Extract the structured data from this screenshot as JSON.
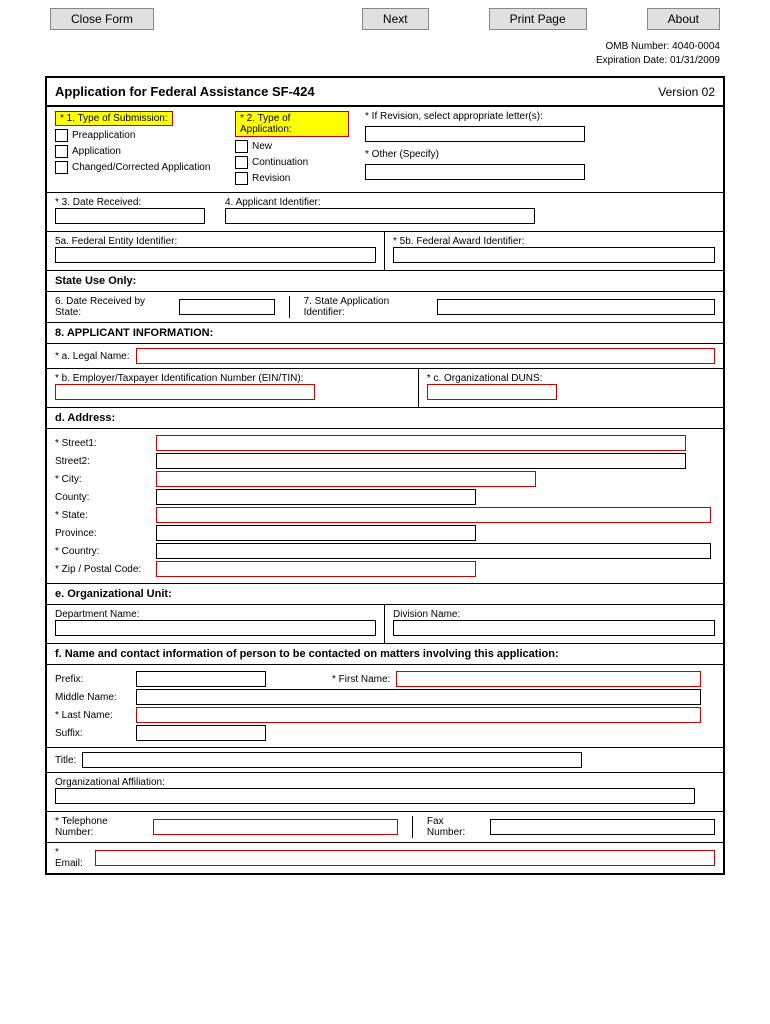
{
  "buttons": {
    "close": "Close Form",
    "next": "Next",
    "print": "Print Page",
    "about": "About"
  },
  "meta": {
    "omb": "OMB Number: 4040-0004",
    "exp": "Expiration Date: 01/31/2009"
  },
  "header": {
    "title": "Application for Federal Assistance SF-424",
    "version": "Version 02"
  },
  "s1": {
    "label": "* 1. Type of Submission:",
    "opt1": "Preapplication",
    "opt2": "Application",
    "opt3": "Changed/Corrected Application"
  },
  "s2": {
    "label": "* 2. Type of Application:",
    "opt1": "New",
    "opt2": "Continuation",
    "opt3": "Revision",
    "rev": "* If Revision, select appropriate letter(s):",
    "other": "* Other (Specify)"
  },
  "s3": {
    "label": "* 3. Date Received:"
  },
  "s4": {
    "label": "4. Applicant Identifier:"
  },
  "s5a": {
    "label": "5a. Federal Entity Identifier:"
  },
  "s5b": {
    "label": "* 5b. Federal Award Identifier:"
  },
  "stateuse": "State Use Only:",
  "s6": {
    "label": "6. Date Received by State:"
  },
  "s7": {
    "label": "7. State Application Identifier:"
  },
  "s8": {
    "heading": "8. APPLICANT INFORMATION:",
    "a": "* a. Legal Name:",
    "b": "* b. Employer/Taxpayer Identification Number (EIN/TIN):",
    "c": "* c. Organizational DUNS:"
  },
  "addr": {
    "heading": "d. Address:",
    "st1": "* Street1:",
    "st2": "Street2:",
    "city": "* City:",
    "county": "County:",
    "state": "* State:",
    "prov": "Province:",
    "country": "* Country:",
    "zip": "* Zip / Postal Code:"
  },
  "org": {
    "heading": "e. Organizational Unit:",
    "dept": "Department Name:",
    "div": "Division Name:"
  },
  "contact": {
    "heading": "f. Name and contact information of person to be contacted on matters involving this application:",
    "prefix": "Prefix:",
    "first": "* First Name:",
    "middle": "Middle Name:",
    "last": "* Last Name:",
    "suffix": "Suffix:",
    "title": "Title:",
    "affil": "Organizational Affiliation:",
    "tel": "* Telephone Number:",
    "fax": "Fax Number:",
    "email": "* Email:"
  }
}
